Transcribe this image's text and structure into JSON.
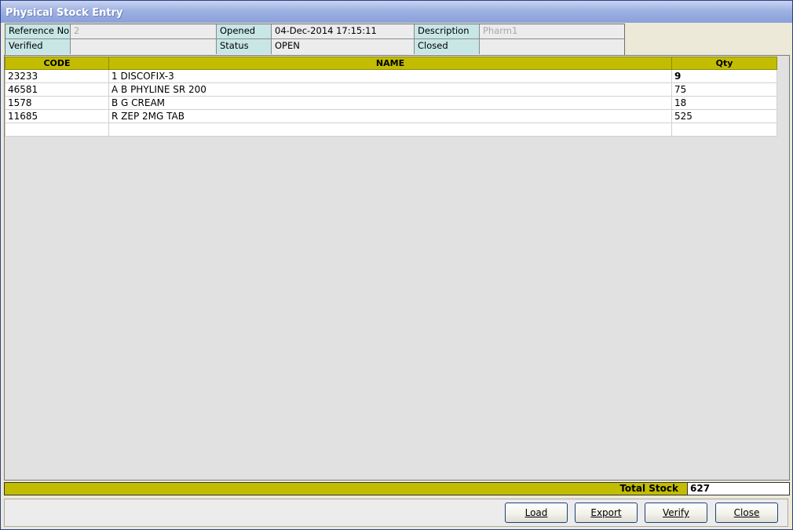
{
  "window": {
    "title": "Physical Stock Entry"
  },
  "info": {
    "reference_no_label": "Reference No",
    "reference_no_value": "2",
    "opened_label": "Opened",
    "opened_value": "04-Dec-2014 17:15:11",
    "description_label": "Description",
    "description_value": "Pharm1",
    "verified_label": "Verified",
    "verified_value": "",
    "status_label": "Status",
    "status_value": "OPEN",
    "closed_label": "Closed",
    "closed_value": ""
  },
  "grid": {
    "headers": [
      "CODE",
      "NAME",
      "Qty"
    ],
    "rows": [
      {
        "code": "23233",
        "name": "1 DISCOFIX-3",
        "qty": "9"
      },
      {
        "code": "46581",
        "name": "A B PHYLINE SR 200",
        "qty": "75"
      },
      {
        "code": "1578",
        "name": "B G CREAM",
        "qty": "18"
      },
      {
        "code": "11685",
        "name": "R ZEP 2MG TAB",
        "qty": "525"
      },
      {
        "code": "",
        "name": "",
        "qty": ""
      }
    ]
  },
  "total": {
    "label": "Total Stock",
    "value": "627"
  },
  "buttons": {
    "load": "Load",
    "export": "Export",
    "verify": "Verify",
    "close": "Close"
  },
  "colors": {
    "accent": "#c2bd00",
    "label_bg": "#c8e6e6",
    "title_bar": "#9fb1e2"
  }
}
